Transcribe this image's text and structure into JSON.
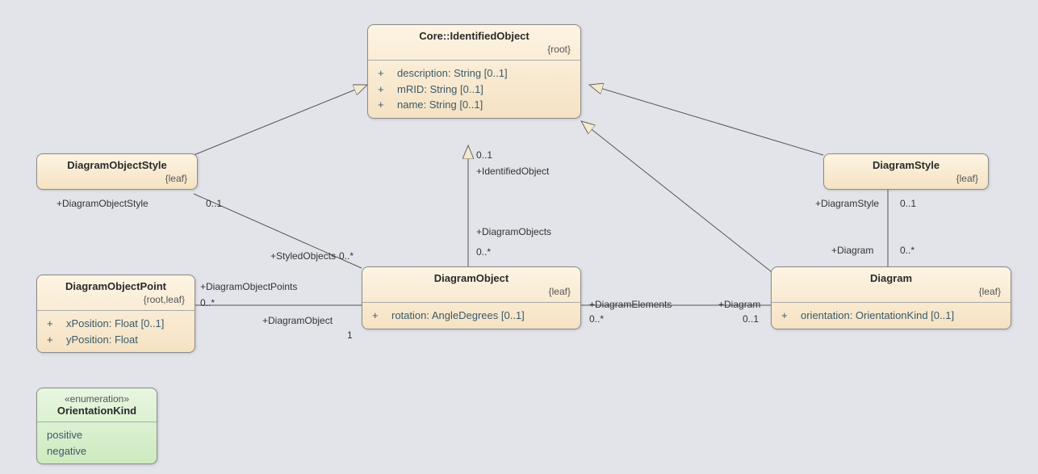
{
  "classes": {
    "identifiedObject": {
      "title": "Core::IdentifiedObject",
      "constraint": "{root}",
      "attrs": [
        {
          "vis": "+",
          "text": "description: String [0..1]"
        },
        {
          "vis": "+",
          "text": "mRID: String [0..1]"
        },
        {
          "vis": "+",
          "text": "name: String [0..1]"
        }
      ]
    },
    "diagramObjectStyle": {
      "title": "DiagramObjectStyle",
      "constraint": "{leaf}"
    },
    "diagramStyle": {
      "title": "DiagramStyle",
      "constraint": "{leaf}"
    },
    "diagramObjectPoint": {
      "title": "DiagramObjectPoint",
      "constraint": "{root,leaf}",
      "attrs": [
        {
          "vis": "+",
          "text": "xPosition: Float [0..1]"
        },
        {
          "vis": "+",
          "text": "yPosition: Float"
        }
      ]
    },
    "diagramObject": {
      "title": "DiagramObject",
      "constraint": "{leaf}",
      "attrs": [
        {
          "vis": "+",
          "text": "rotation: AngleDegrees [0..1]"
        }
      ]
    },
    "diagram": {
      "title": "Diagram",
      "constraint": "{leaf}",
      "attrs": [
        {
          "vis": "+",
          "text": "orientation: OrientationKind [0..1]"
        }
      ]
    },
    "orientationKind": {
      "stereo": "«enumeration»",
      "title": "OrientationKind",
      "literals": [
        "positive",
        "negative"
      ]
    }
  },
  "labels": {
    "identifiedObject_role": "+IdentifiedObject",
    "identifiedObject_card": "0..1",
    "diagramObjects_role": "+DiagramObjects",
    "diagramObjects_card": "0..*",
    "diagramObjectStyle_role": "+DiagramObjectStyle",
    "diagramObjectStyle_card": "0..1",
    "styledObjects_role": "+StyledObjects",
    "styledObjects_card": "0..*",
    "diagramObjectPoints_role": "+DiagramObjectPoints",
    "diagramObjectPoints_card": "0..*",
    "diagramObject_role": "+DiagramObject",
    "diagramObject_card": "1",
    "diagramElements_role": "+DiagramElements",
    "diagramElements_card": "0..*",
    "diagram_role_right": "+Diagram",
    "diagram_card_right": "0..1",
    "diagramStyle_role": "+DiagramStyle",
    "diagramStyle_card": "0..1",
    "diagram_role_mid": "+Diagram",
    "diagram_card_mid": "0..*"
  }
}
